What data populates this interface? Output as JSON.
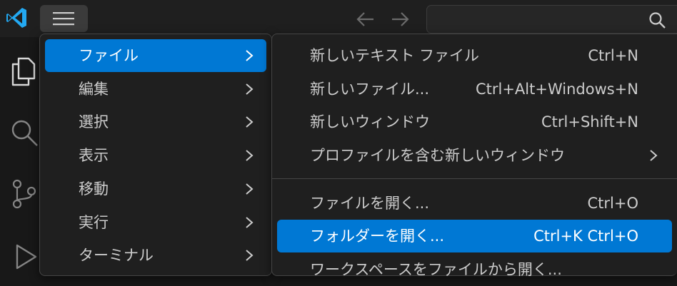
{
  "titlebar": {
    "logo_icon": "vscode-logo",
    "menu_icon": "hamburger-menu-icon",
    "back_icon": "arrow-left-icon",
    "forward_icon": "arrow-right-icon",
    "search_icon": "search-icon",
    "search_value": ""
  },
  "activitybar": {
    "items": [
      {
        "icon": "files-icon"
      },
      {
        "icon": "search-icon"
      },
      {
        "icon": "source-control-icon"
      },
      {
        "icon": "run-debug-icon"
      }
    ]
  },
  "main_menu": {
    "items": [
      {
        "label": "ファイル",
        "selected": true
      },
      {
        "label": "編集"
      },
      {
        "label": "選択"
      },
      {
        "label": "表示"
      },
      {
        "label": "移動"
      },
      {
        "label": "実行"
      },
      {
        "label": "ターミナル"
      }
    ]
  },
  "file_menu": {
    "items": [
      {
        "label": "新しいテキスト ファイル",
        "shortcut": "Ctrl+N"
      },
      {
        "label": "新しいファイル...",
        "shortcut": "Ctrl+Alt+Windows+N"
      },
      {
        "label": "新しいウィンドウ",
        "shortcut": "Ctrl+Shift+N"
      },
      {
        "label": "プロファイルを含む新しいウィンドウ",
        "shortcut": ""
      },
      {
        "label": "ファイルを開く...",
        "shortcut": "Ctrl+O"
      },
      {
        "label": "フォルダーを開く...",
        "shortcut": "Ctrl+K Ctrl+O",
        "selected": true
      },
      {
        "label": "ワークスペースをファイルから開く...",
        "shortcut": ""
      }
    ]
  },
  "colors": {
    "accent": "#0078d4",
    "background": "#181818",
    "menu_background": "#1f1f1f",
    "text": "#cccccc"
  }
}
